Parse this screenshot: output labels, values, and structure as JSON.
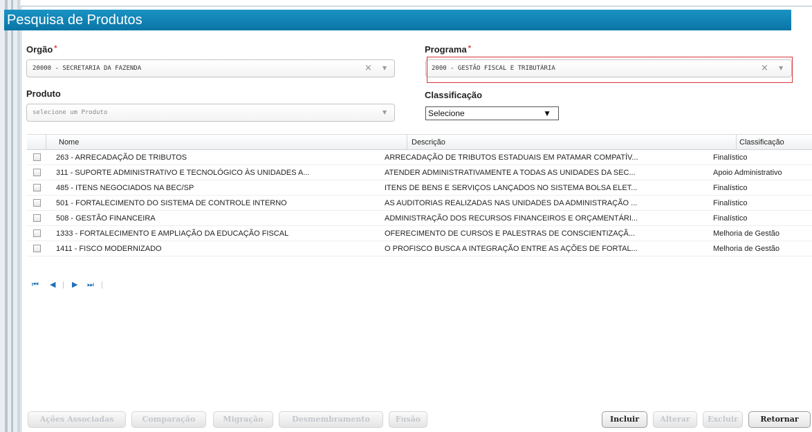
{
  "title": "Pesquisa de Produtos",
  "orgao": {
    "label": "Orgão",
    "required_mark": "*",
    "value": "20000 - SECRETARIA DA FAZENDA"
  },
  "programa": {
    "label": "Programa",
    "required_mark": "*",
    "value": "2000 - GESTÃO FISCAL E TRIBUTÁRIA"
  },
  "produto": {
    "label": "Produto",
    "placeholder": "selecione um Produto"
  },
  "classificacao": {
    "label": "Classificação",
    "selected": "Selecione"
  },
  "icons": {
    "clear": "×",
    "dropdown": "▼",
    "select_arrow": "▼"
  },
  "grid": {
    "columns": [
      "Nome",
      "Descrição",
      "Classificação"
    ],
    "rows": [
      {
        "nome": "263 - ARRECADAÇÃO DE TRIBUTOS",
        "descricao": "ARRECADAÇÃO DE TRIBUTOS ESTADUAIS EM PATAMAR COMPATÍV...",
        "classificacao": "Finalístico"
      },
      {
        "nome": "311 - SUPORTE ADMINISTRATIVO E TECNOLÓGICO ÀS UNIDADES A...",
        "descricao": "ATENDER ADMINISTRATIVAMENTE A TODAS AS UNIDADES DA SEC...",
        "classificacao": "Apoio Administrativo"
      },
      {
        "nome": "485 - ITENS NEGOCIADOS NA BEC/SP",
        "descricao": "ITENS DE BENS E SERVIÇOS LANÇADOS NO SISTEMA BOLSA ELET...",
        "classificacao": "Finalístico"
      },
      {
        "nome": "501 - FORTALECIMENTO DO SISTEMA DE CONTROLE INTERNO",
        "descricao": "AS AUDITORIAS REALIZADAS NAS UNIDADES DA ADMINISTRAÇÃO ...",
        "classificacao": "Finalístico"
      },
      {
        "nome": "508 - GESTÃO FINANCEIRA",
        "descricao": "ADMINISTRAÇÃO DOS RECURSOS FINANCEIROS E ORÇAMENTÁRI...",
        "classificacao": "Finalístico"
      },
      {
        "nome": "1333 - FORTALECIMENTO E AMPLIAÇÃO DA EDUCAÇÃO FISCAL",
        "descricao": "OFERECIMENTO DE CURSOS E PALESTRAS DE CONSCIENTIZAÇÃ...",
        "classificacao": "Melhoria de Gestão"
      },
      {
        "nome": "1411 - FISCO MODERNIZADO",
        "descricao": "O PROFISCO BUSCA A INTEGRAÇÃO ENTRE AS AÇÕES DE FORTAL...",
        "classificacao": "Melhoria de Gestão"
      }
    ]
  },
  "pager": {
    "first": "⏮",
    "prev": "◀",
    "sep": "|",
    "next": "▶",
    "last": "⏭"
  },
  "buttons": {
    "acoes_associadas": "Ações Associadas",
    "comparacao": "Comparação",
    "migracao": "Migração",
    "desmembramento": "Desmembramento",
    "fusao": "Fusão",
    "incluir": "Incluir",
    "alterar": "Alterar",
    "excluir": "Excluir",
    "retornar": "Retornar"
  },
  "colors": {
    "title_bar": "#0a75a6",
    "required": "#e23b3b",
    "highlight": "#d9333a",
    "pager": "#1f6fb8"
  }
}
